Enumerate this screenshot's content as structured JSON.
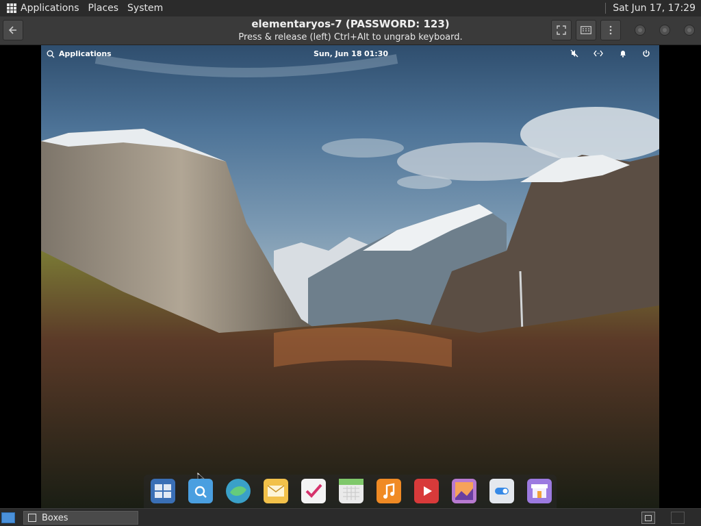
{
  "host_panel": {
    "menus": [
      "Applications",
      "Places",
      "System"
    ],
    "clock": "Sat Jun 17, 17:29",
    "icons": [
      "apps-grid-icon"
    ]
  },
  "titlebar": {
    "title": "elementaryos-7 (PASSWORD: 123)",
    "subtitle": "Press & release (left) Ctrl+Alt to ungrab keyboard.",
    "buttons": [
      "back-arrow-icon",
      "fullscreen-icon",
      "keyboard-icon",
      "menu-dots-icon"
    ],
    "window_controls": [
      "minimize",
      "maximize",
      "close"
    ]
  },
  "guest": {
    "panel": {
      "applications_label": "Applications",
      "date": "Sun, Jun 18",
      "time": "01:30",
      "indicators": [
        "mute-icon",
        "network-icon",
        "notifications-bell-icon",
        "power-icon"
      ]
    },
    "dock_apps": [
      {
        "name": "multitasking-view",
        "color": "#3a6fb5"
      },
      {
        "name": "files",
        "color": "#4a9fe0"
      },
      {
        "name": "web-browser",
        "color": "#3aa0c8"
      },
      {
        "name": "mail",
        "color": "#f2c14a"
      },
      {
        "name": "tasks",
        "color": "#f4f4f4"
      },
      {
        "name": "calendar",
        "color": "#eaeaea"
      },
      {
        "name": "music",
        "color": "#f08a24"
      },
      {
        "name": "videos",
        "color": "#d83a3a"
      },
      {
        "name": "photos",
        "color": "#b87ad0"
      },
      {
        "name": "system-settings",
        "color": "#e4e8ee"
      },
      {
        "name": "appcenter",
        "color": "#9c7ae0"
      }
    ]
  },
  "host_taskbar": {
    "task_label": "Boxes"
  }
}
